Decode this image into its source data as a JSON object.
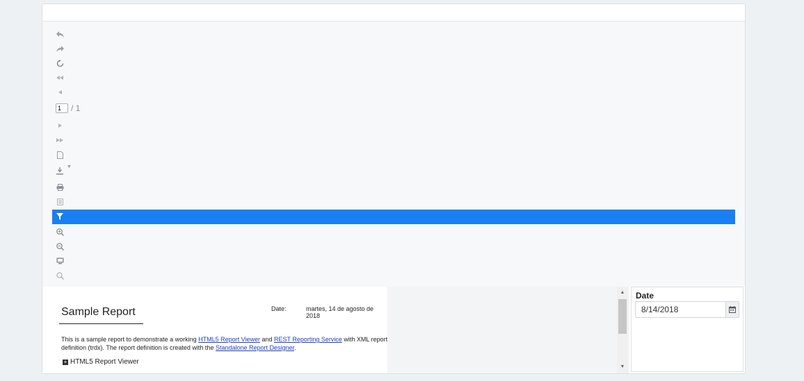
{
  "toolbar": {
    "items": [
      {
        "name": "back-icon",
        "glyph": "↶"
      },
      {
        "name": "forward-icon",
        "glyph": "↷"
      },
      {
        "name": "refresh-icon",
        "glyph": "↻"
      },
      {
        "name": "first-page-icon",
        "glyph": "◂◂"
      },
      {
        "name": "previous-page-icon",
        "glyph": "◂"
      }
    ],
    "pager": {
      "current_page": "1",
      "total": "/ 1"
    },
    "items_after": [
      {
        "name": "next-page-icon",
        "glyph": "▸"
      },
      {
        "name": "last-page-icon",
        "glyph": "▸▸"
      },
      {
        "name": "print-preview-icon",
        "glyph": "🗋"
      },
      {
        "name": "export-icon",
        "glyph": "⤓",
        "caret": "▼"
      },
      {
        "name": "print-icon",
        "glyph": "⎙"
      },
      {
        "name": "document-map-icon",
        "glyph": "▤"
      },
      {
        "name": "filter-icon",
        "glyph": "▼",
        "active": true
      },
      {
        "name": "zoom-in-icon",
        "glyph": "⊕"
      },
      {
        "name": "zoom-out-icon",
        "glyph": "⊖"
      },
      {
        "name": "toggle-page-size-icon",
        "glyph": "▣"
      },
      {
        "name": "search-icon",
        "glyph": "⚲"
      }
    ]
  },
  "report": {
    "title": "Sample Report",
    "date_label": "Date:",
    "date_value": "martes, 14 de agosto de 2018",
    "desc_part1": "This is a sample report to demonstrate a working ",
    "link1": "HTML5 Report Viewer",
    "desc_part2": " and ",
    "link2": "REST Reporting Service",
    "desc_part3": " with XML report definition (trdx). The report definition is created with the ",
    "link3": "Standalone Report Designer",
    "desc_part4": ".",
    "section_label": "HTML5 Report Viewer"
  },
  "parameters": {
    "date_label": "Date",
    "date_value": "8/14/2018"
  },
  "colors": {
    "active_bar": "#1a7ff0",
    "link": "#1f3fbf"
  }
}
